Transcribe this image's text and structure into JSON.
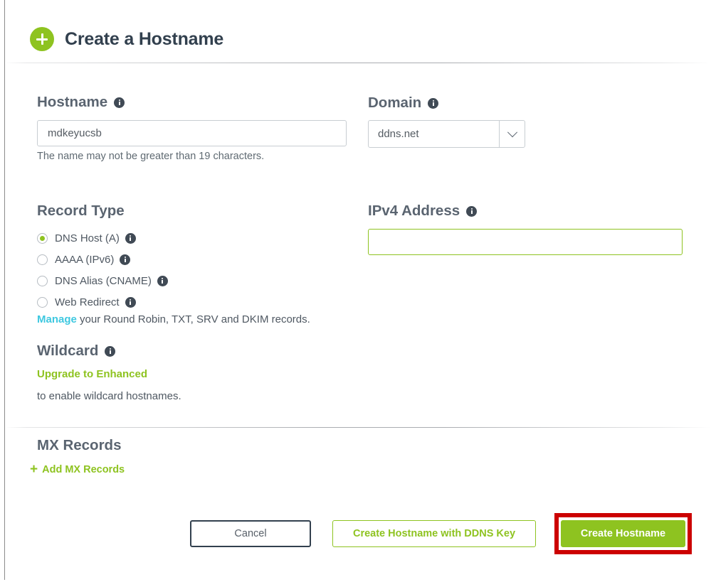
{
  "header": {
    "title": "Create a Hostname",
    "icon": "plus-circle-icon"
  },
  "form": {
    "hostname": {
      "label": "Hostname",
      "value": "mdkeyucsb",
      "placeholder": "",
      "hint": "The name may not be greater than 19 characters.",
      "info_icon": "info-icon"
    },
    "domain": {
      "label": "Domain",
      "selected": "ddns.net",
      "chevron_icon": "chevron-down-icon",
      "info_icon": "info-icon"
    },
    "record_type": {
      "label": "Record Type",
      "options": [
        {
          "label": "DNS Host (A)",
          "checked": true
        },
        {
          "label": "AAAA (IPv6)",
          "checked": false
        },
        {
          "label": "DNS Alias (CNAME)",
          "checked": false
        },
        {
          "label": "Web Redirect",
          "checked": false
        }
      ],
      "manage_link": "Manage",
      "manage_rest": " your Round Robin, TXT, SRV and DKIM records."
    },
    "ipv4": {
      "label": "IPv4 Address",
      "value": "",
      "placeholder": "",
      "info_icon": "info-icon"
    },
    "wildcard": {
      "label": "Wildcard",
      "upgrade_link": "Upgrade to Enhanced",
      "note": "to enable wildcard hostnames.",
      "info_icon": "info-icon"
    },
    "mx_records": {
      "title": "MX Records",
      "add_label": "Add MX Records",
      "add_plus": "+"
    }
  },
  "footer": {
    "cancel_label": "Cancel",
    "ddns_label": "Create Hostname with DDNS Key",
    "create_label": "Create Hostname"
  },
  "colors": {
    "brand_green": "#8ec320",
    "link_cyan": "#3ec8e0",
    "heading_slate": "#32404e",
    "annotation_red": "#cc0000"
  }
}
